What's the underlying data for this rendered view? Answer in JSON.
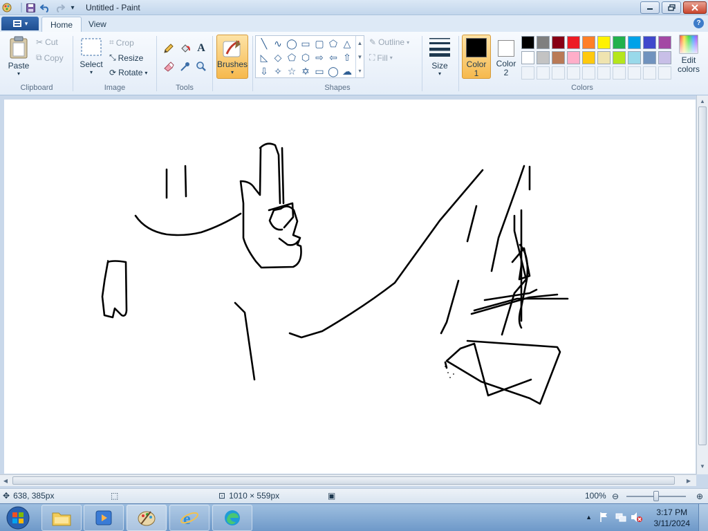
{
  "window": {
    "title": "Untitled - Paint",
    "quick_access": [
      "save-icon",
      "undo-icon",
      "redo-icon",
      "customize-dropdown-icon"
    ],
    "controls": [
      "minimize",
      "restore",
      "close"
    ]
  },
  "tabs": [
    {
      "label": "Home",
      "active": true
    },
    {
      "label": "View",
      "active": false
    }
  ],
  "ribbon": {
    "clipboard": {
      "group_label": "Clipboard",
      "paste": "Paste",
      "cut": "Cut",
      "copy": "Copy"
    },
    "image": {
      "group_label": "Image",
      "select": "Select",
      "crop": "Crop",
      "resize": "Resize",
      "rotate": "Rotate"
    },
    "tools": {
      "group_label": "Tools",
      "items": [
        "pencil-icon",
        "fill-icon",
        "text-icon",
        "eraser-icon",
        "color-picker-icon",
        "magnifier-icon"
      ]
    },
    "brushes": {
      "label": "Brushes"
    },
    "shapes": {
      "group_label": "Shapes",
      "outline": "Outline",
      "fill": "Fill",
      "items": [
        "line",
        "curve",
        "oval",
        "rectangle",
        "rounded-rectangle",
        "polygon",
        "triangle",
        "right-triangle",
        "diamond",
        "pentagon",
        "hexagon",
        "right-arrow",
        "left-arrow",
        "up-arrow",
        "down-arrow",
        "four-point-star",
        "five-point-star",
        "six-point-star",
        "rounded-callout",
        "oval-callout",
        "cloud-callout"
      ]
    },
    "size": {
      "label": "Size"
    },
    "colors": {
      "group_label": "Colors",
      "color1_label": "Color",
      "color1_number": "1",
      "color1_value": "#000000",
      "color2_label": "Color",
      "color2_number": "2",
      "color2_value": "#ffffff",
      "edit_colors": "Edit colors",
      "palette_row1": [
        "#000000",
        "#7f7f7f",
        "#880015",
        "#ed1c24",
        "#ff7f27",
        "#fff200",
        "#22b14c",
        "#00a2e8",
        "#3f48cc",
        "#a349a4"
      ],
      "palette_row2": [
        "#ffffff",
        "#c3c3c3",
        "#b97a57",
        "#ffaec9",
        "#ffc90e",
        "#efe4b0",
        "#b5e61d",
        "#99d9ea",
        "#7092be",
        "#c8bfe7"
      ]
    }
  },
  "statusbar": {
    "cursor_position": "638, 385px",
    "canvas_size": "1010 × 559px",
    "zoom": "100%"
  },
  "taskbar": {
    "items": [
      "explorer",
      "media-player",
      "paint",
      "internet-explorer",
      "edge"
    ],
    "active": "paint",
    "clock_time": "3:17 PM",
    "clock_date": "3/11/2024"
  }
}
